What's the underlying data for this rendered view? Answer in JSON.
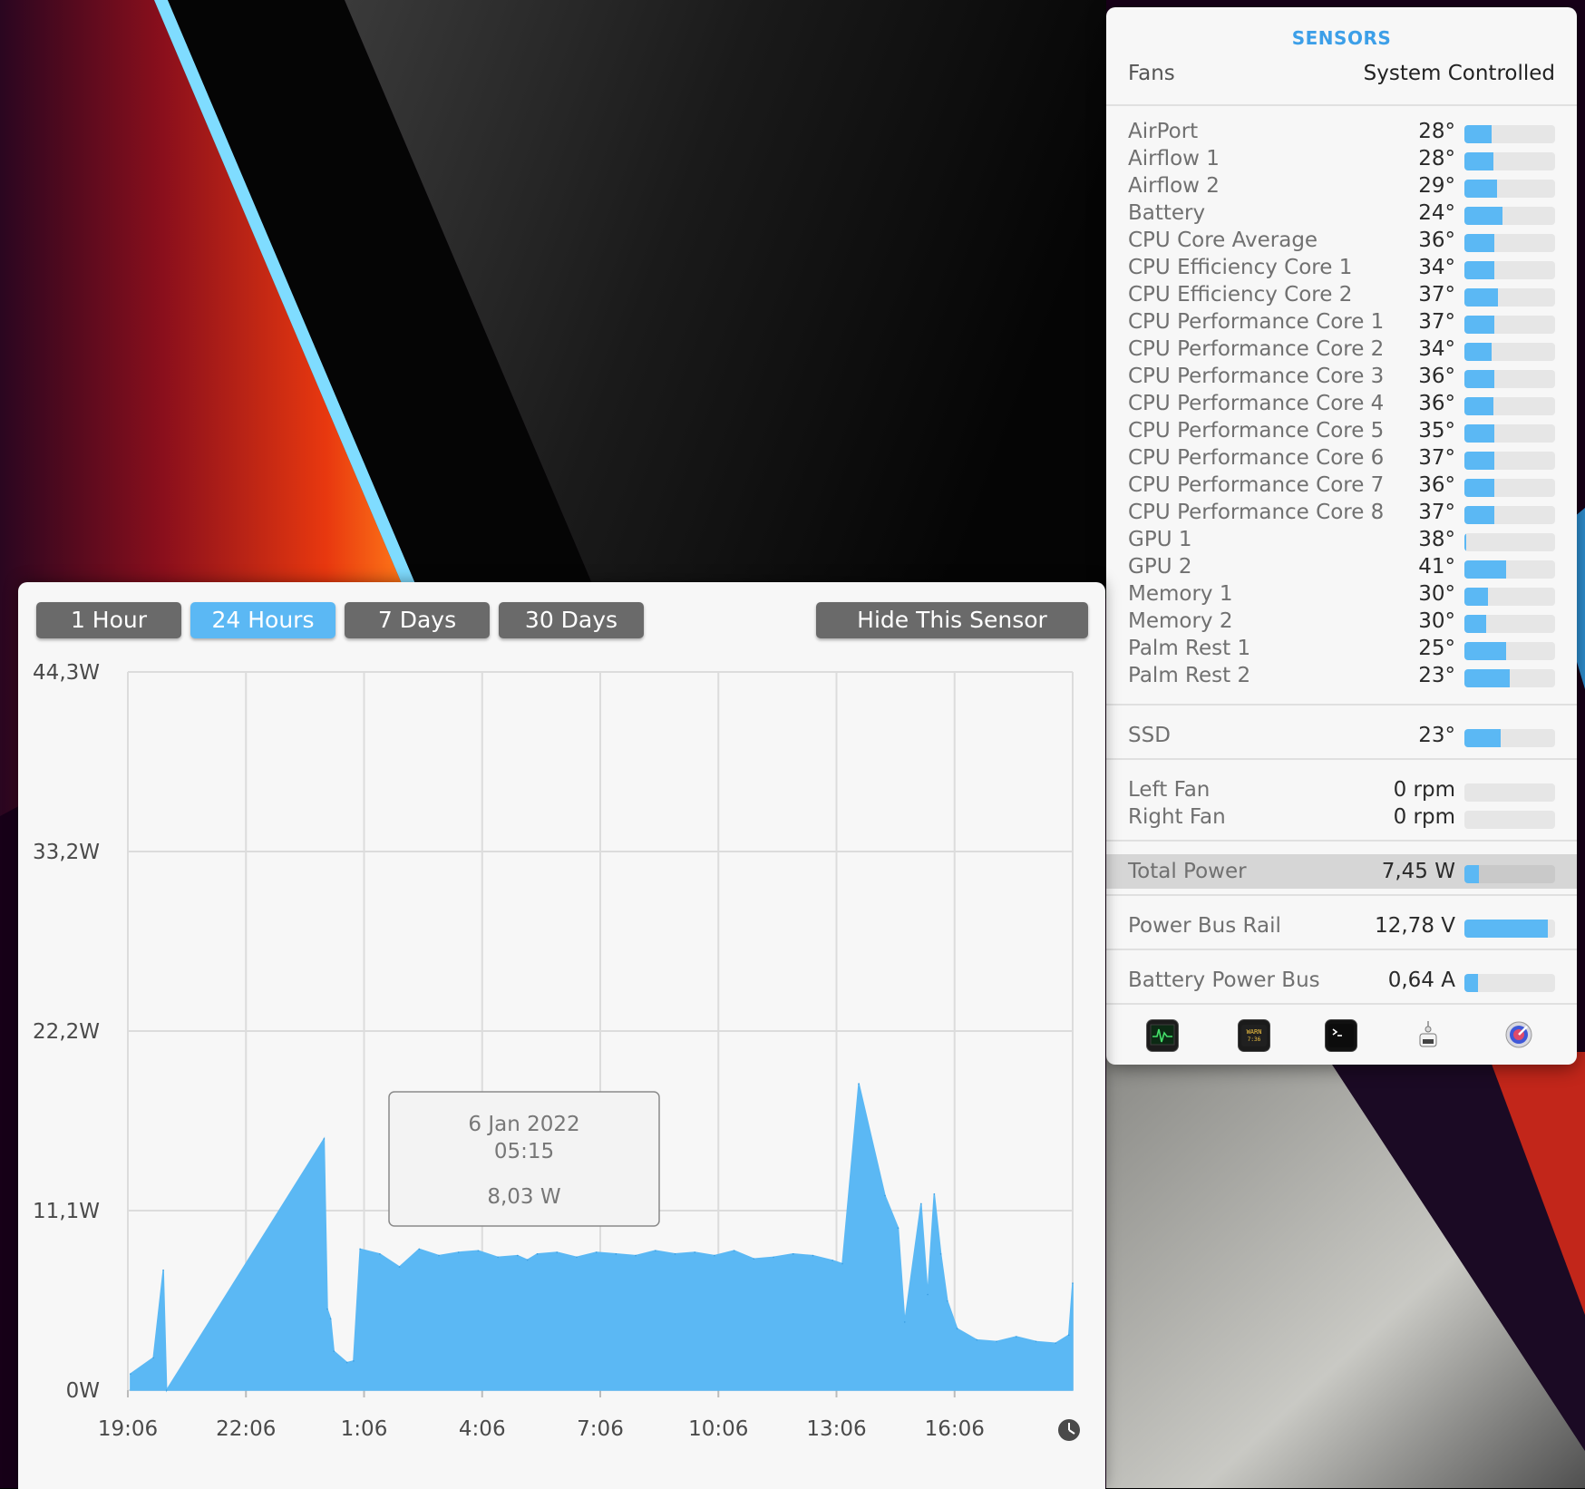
{
  "sensors": {
    "title": "SENSORS",
    "fans": {
      "label": "Fans",
      "value": "System Controlled"
    },
    "temps": [
      {
        "name": "AirPort",
        "value": "28°",
        "level": 0.3
      },
      {
        "name": "Airflow 1",
        "value": "28°",
        "level": 0.32
      },
      {
        "name": "Airflow 2",
        "value": "29°",
        "level": 0.36
      },
      {
        "name": "Battery",
        "value": "24°",
        "level": 0.42
      },
      {
        "name": "CPU Core Average",
        "value": "36°",
        "level": 0.33
      },
      {
        "name": "CPU Efficiency Core 1",
        "value": "34°",
        "level": 0.33
      },
      {
        "name": "CPU Efficiency Core 2",
        "value": "37°",
        "level": 0.37
      },
      {
        "name": "CPU Performance Core 1",
        "value": "37°",
        "level": 0.33
      },
      {
        "name": "CPU Performance Core 2",
        "value": "34°",
        "level": 0.3
      },
      {
        "name": "CPU Performance Core 3",
        "value": "36°",
        "level": 0.33
      },
      {
        "name": "CPU Performance Core 4",
        "value": "36°",
        "level": 0.32
      },
      {
        "name": "CPU Performance Core 5",
        "value": "35°",
        "level": 0.33
      },
      {
        "name": "CPU Performance Core 6",
        "value": "37°",
        "level": 0.33
      },
      {
        "name": "CPU Performance Core 7",
        "value": "36°",
        "level": 0.33
      },
      {
        "name": "CPU Performance Core 8",
        "value": "37°",
        "level": 0.33
      },
      {
        "name": "GPU 1",
        "value": "38°",
        "level": 0.02
      },
      {
        "name": "GPU 2",
        "value": "41°",
        "level": 0.46
      },
      {
        "name": "Memory 1",
        "value": "30°",
        "level": 0.26
      },
      {
        "name": "Memory 2",
        "value": "30°",
        "level": 0.24
      },
      {
        "name": "Palm Rest 1",
        "value": "25°",
        "level": 0.46
      },
      {
        "name": "Palm Rest 2",
        "value": "23°",
        "level": 0.5
      }
    ],
    "ssd": {
      "name": "SSD",
      "value": "23°",
      "level": 0.4
    },
    "fan_speeds": [
      {
        "name": "Left Fan",
        "value": "0 rpm",
        "level": 0
      },
      {
        "name": "Right Fan",
        "value": "0 rpm",
        "level": 0
      }
    ],
    "total_power": {
      "name": "Total Power",
      "value": "7,45 W",
      "level": 0.16
    },
    "power_bus_rail": {
      "name": "Power Bus Rail",
      "value": "12,78 V",
      "level": 0.92
    },
    "battery_power_bus": {
      "name": "Battery Power Bus",
      "value": "0,64 A",
      "level": 0.15
    },
    "dock_icons": [
      "activity-monitor-icon",
      "console-icon",
      "terminal-icon",
      "system-information-icon",
      "disk-utility-icon"
    ],
    "colors": {
      "accent": "#3c9fe8",
      "bar_fill": "#5bb8f4",
      "bar_track": "#e6e6e6"
    }
  },
  "chart_window": {
    "buttons": {
      "one_hour": "1 Hour",
      "twenty_four_hours": "24 Hours",
      "seven_days": "7 Days",
      "thirty_days": "30 Days",
      "hide_sensor": "Hide This Sensor"
    },
    "active_range": "24 Hours",
    "tooltip": {
      "date": "6 Jan 2022",
      "time": "05:15",
      "value": "8,03 W"
    },
    "colors": {
      "area": "#5bb8f4",
      "active_button": "#5bb8f4",
      "button": "#6a6a6a"
    }
  },
  "chart_data": {
    "type": "area",
    "title": "",
    "xlabel": "",
    "ylabel": "",
    "y_ticks": [
      "44,3W",
      "33,2W",
      "22,2W",
      "11,1W",
      "0W"
    ],
    "ylim": [
      0,
      44.3
    ],
    "x_ticks": [
      "19:06",
      "22:06",
      "1:06",
      "4:06",
      "7:06",
      "10:06",
      "13:06",
      "16:06"
    ],
    "xlim": [
      "19:06",
      "19:06"
    ],
    "grid": true,
    "series": [
      {
        "unit": "W",
        "x": [
          "19:10",
          "19:45",
          "20:00",
          "20:05",
          "0:05",
          "0:10",
          "0:15",
          "0:20",
          "0:40",
          "0:50",
          "1:00",
          "1:30",
          "2:00",
          "2:30",
          "3:00",
          "3:30",
          "4:00",
          "4:30",
          "5:00",
          "5:15",
          "5:30",
          "6:00",
          "6:30",
          "7:00",
          "7:30",
          "8:00",
          "8:30",
          "9:00",
          "9:30",
          "10:00",
          "10:30",
          "11:00",
          "11:30",
          "12:00",
          "12:30",
          "13:00",
          "13:15",
          "13:40",
          "14:20",
          "14:40",
          "14:50",
          "15:15",
          "15:25",
          "15:35",
          "15:45",
          "15:55",
          "16:10",
          "16:40",
          "17:10",
          "17:40",
          "18:10",
          "18:40",
          "19:00",
          "19:06"
        ],
        "y": [
          1.0,
          2.0,
          7.4,
          0.0,
          15.5,
          5.0,
          4.4,
          2.4,
          1.7,
          1.8,
          8.7,
          8.4,
          7.6,
          8.7,
          8.3,
          8.5,
          8.6,
          8.2,
          8.3,
          8.03,
          8.4,
          8.5,
          8.2,
          8.5,
          8.4,
          8.3,
          8.6,
          8.4,
          8.5,
          8.3,
          8.6,
          8.1,
          8.2,
          8.4,
          8.3,
          8.0,
          7.8,
          18.9,
          12.0,
          10.0,
          4.2,
          11.5,
          5.9,
          12.1,
          8.4,
          5.5,
          3.8,
          3.1,
          3.0,
          3.3,
          3.0,
          2.9,
          3.4,
          6.6
        ]
      }
    ]
  }
}
